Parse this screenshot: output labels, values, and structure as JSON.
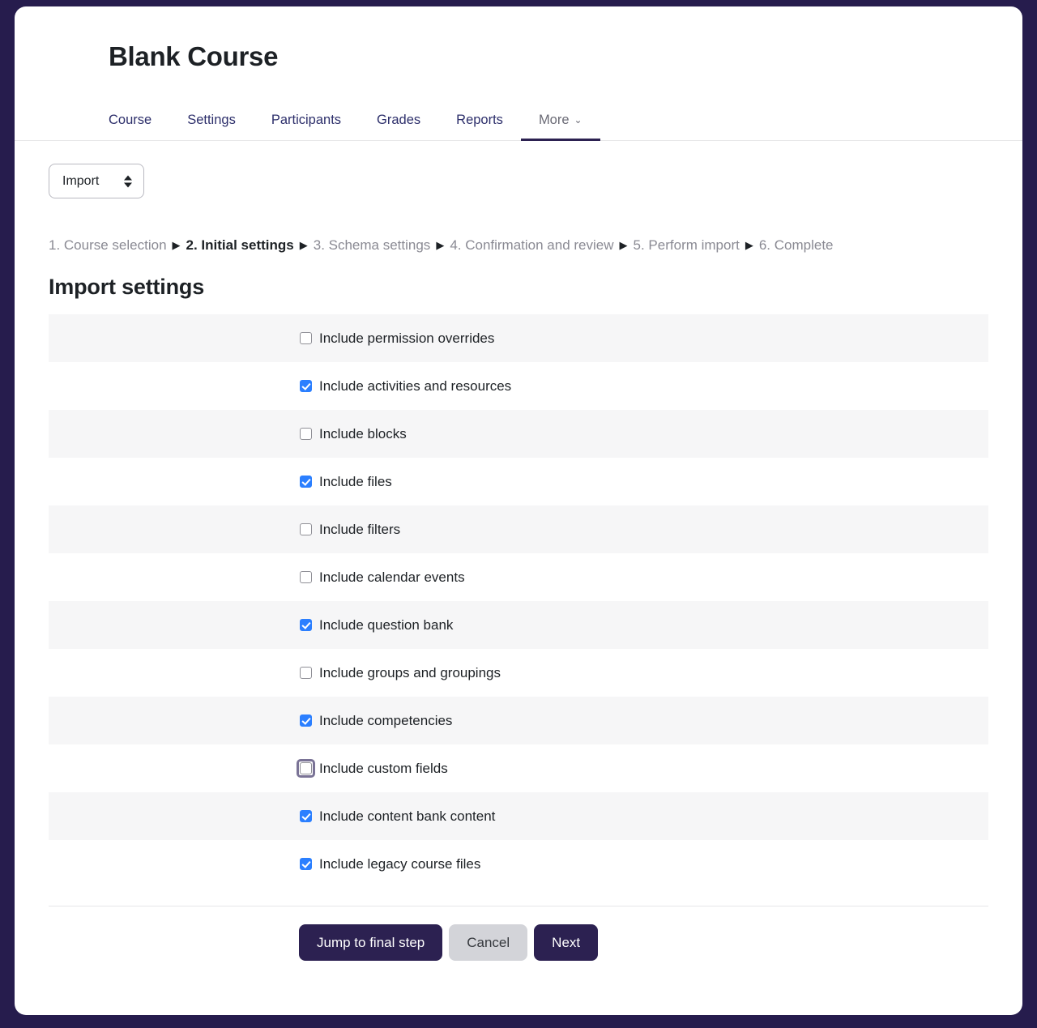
{
  "theme": {
    "page_background": "#261c4d",
    "card_background": "#ffffff",
    "accent": "#2c2151",
    "checkbox_checked": "#2b7fff",
    "stripe": "#f6f6f7",
    "focus_ring": "#7a7396"
  },
  "header": {
    "course_title": "Blank Course",
    "tabs": [
      {
        "label": "Course",
        "active": false
      },
      {
        "label": "Settings",
        "active": false
      },
      {
        "label": "Participants",
        "active": false
      },
      {
        "label": "Grades",
        "active": false
      },
      {
        "label": "Reports",
        "active": false
      },
      {
        "label": "More",
        "active": true,
        "has_chevron": true
      }
    ]
  },
  "jump_menu": {
    "selected": "Import",
    "options": [
      "Import"
    ]
  },
  "breadcrumb": {
    "separator": "▶",
    "steps": [
      {
        "label": "1. Course selection",
        "current": false
      },
      {
        "label": "2. Initial settings",
        "current": true
      },
      {
        "label": "3. Schema settings",
        "current": false
      },
      {
        "label": "4. Confirmation and review",
        "current": false
      },
      {
        "label": "5. Perform import",
        "current": false
      },
      {
        "label": "6. Complete",
        "current": false
      }
    ]
  },
  "main": {
    "section_title": "Import settings",
    "settings": [
      {
        "label": "Include permission overrides",
        "checked": false,
        "focused": false
      },
      {
        "label": "Include activities and resources",
        "checked": true,
        "focused": false
      },
      {
        "label": "Include blocks",
        "checked": false,
        "focused": false
      },
      {
        "label": "Include files",
        "checked": true,
        "focused": false
      },
      {
        "label": "Include filters",
        "checked": false,
        "focused": false
      },
      {
        "label": "Include calendar events",
        "checked": false,
        "focused": false
      },
      {
        "label": "Include question bank",
        "checked": true,
        "focused": false
      },
      {
        "label": "Include groups and groupings",
        "checked": false,
        "focused": false
      },
      {
        "label": "Include competencies",
        "checked": true,
        "focused": false
      },
      {
        "label": "Include custom fields",
        "checked": false,
        "focused": true
      },
      {
        "label": "Include content bank content",
        "checked": true,
        "focused": false
      },
      {
        "label": "Include legacy course files",
        "checked": true,
        "focused": false
      }
    ]
  },
  "footer": {
    "buttons": [
      {
        "label": "Jump to final step",
        "style": "primary"
      },
      {
        "label": "Cancel",
        "style": "secondary"
      },
      {
        "label": "Next",
        "style": "primary"
      }
    ]
  }
}
